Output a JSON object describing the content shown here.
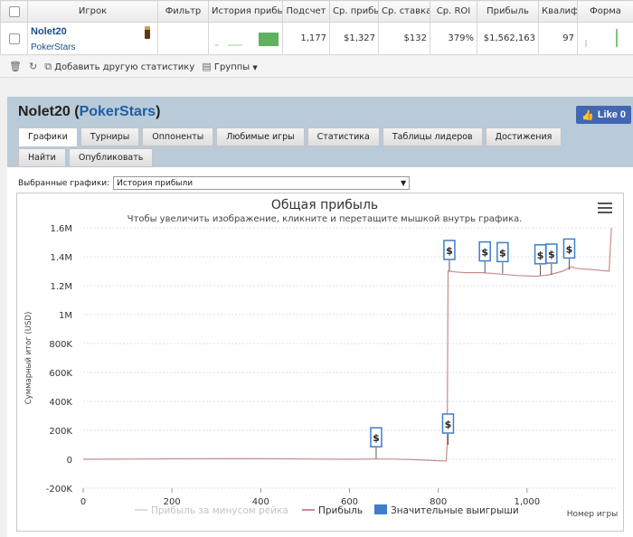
{
  "table": {
    "headers": [
      "Игрок",
      "Фильтр",
      "История прибыль",
      "Подсчет",
      "Ср. прибыль",
      "Ср. ставка",
      "Ср. ROI",
      "Прибыль",
      "Квалиф",
      "Форма"
    ],
    "row": {
      "player": "Nolet20",
      "site": "PokerStars",
      "count": "1,177",
      "avg_profit": "$1,327",
      "avg_stake": "$132",
      "avg_roi": "379%",
      "profit": "$1,562,163",
      "quality": "97"
    }
  },
  "toolbar": {
    "add_stats": "Добавить другую статистику",
    "groups": "Группы"
  },
  "panel": {
    "player": "Nolet20",
    "site": "PokerStars",
    "like": "Like 0",
    "tabs": [
      "Графики",
      "Турниры",
      "Оппоненты",
      "Любимые игры",
      "Статистика",
      "Таблицы лидеров",
      "Достижения",
      "Найти",
      "Опубликовать"
    ],
    "select_label": "Выбранные графики:",
    "select_value": "История прибыли"
  },
  "chart_data": {
    "type": "line",
    "title": "Общая прибыль",
    "subtitle": "Чтобы увеличить изображение, кликните и перетащите мышкой внутрь графика.",
    "ylabel": "Суммарный итог (USD)",
    "xlabel": "Номер игры",
    "xlim": [
      0,
      1200
    ],
    "ylim": [
      -200000,
      1600000
    ],
    "xticks": [
      0,
      200,
      400,
      600,
      800,
      1000
    ],
    "xtick_labels": [
      "0",
      "200",
      "400",
      "600",
      "800",
      "1,000"
    ],
    "yticks": [
      -200000,
      0,
      200000,
      400000,
      600000,
      800000,
      1000000,
      1200000,
      1400000,
      1600000
    ],
    "ytick_labels": [
      "-200K",
      "0",
      "200K",
      "400K",
      "600K",
      "800K",
      "1M",
      "1.2M",
      "1.4M",
      "1.6M"
    ],
    "legend_position": "bottom",
    "series": [
      {
        "name": "Прибыль за минусом рейка",
        "color": "#dddddd",
        "x": [],
        "y": []
      },
      {
        "name": "Прибыль",
        "color": "#c98c8c",
        "x": [
          0,
          100,
          200,
          300,
          400,
          500,
          600,
          660,
          700,
          750,
          800,
          818,
          820,
          822,
          825,
          840,
          860,
          900,
          940,
          980,
          1020,
          1035,
          1050,
          1080,
          1100,
          1110,
          1150,
          1185,
          1190
        ],
        "y": [
          0,
          1000,
          3000,
          4000,
          4000,
          2000,
          0,
          2000,
          1000,
          -3000,
          -10000,
          -12000,
          100000,
          1300000,
          1300000,
          1295000,
          1290000,
          1290000,
          1280000,
          1270000,
          1265000,
          1270000,
          1275000,
          1300000,
          1330000,
          1320000,
          1310000,
          1300000,
          1600000
        ]
      },
      {
        "name": "Значительные выигрыши",
        "color": "#3d7fc8",
        "x": [],
        "y": []
      }
    ],
    "markers": [
      {
        "x": 660,
        "y": 5000,
        "label": "$"
      },
      {
        "x": 822,
        "y": 100000,
        "label": "$"
      },
      {
        "x": 825,
        "y": 1300000,
        "label": "$"
      },
      {
        "x": 905,
        "y": 1290000,
        "label": "$"
      },
      {
        "x": 945,
        "y": 1285000,
        "label": "$"
      },
      {
        "x": 1030,
        "y": 1270000,
        "label": "$"
      },
      {
        "x": 1055,
        "y": 1275000,
        "label": "$"
      },
      {
        "x": 1095,
        "y": 1310000,
        "label": "$"
      }
    ]
  }
}
